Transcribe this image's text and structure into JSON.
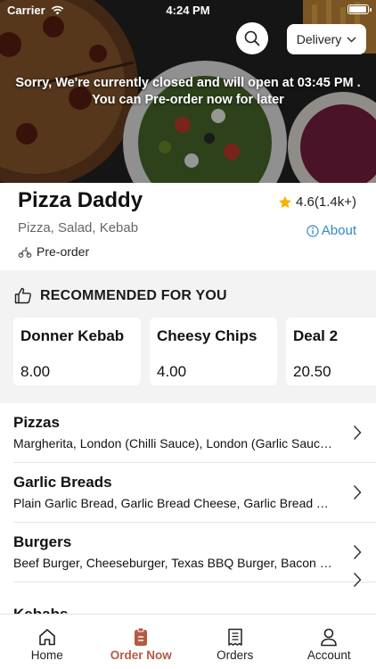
{
  "status_bar": {
    "carrier": "Carrier",
    "time": "4:24 PM"
  },
  "hero": {
    "message_line1": "Sorry, We're currently closed and will open at 03:45 PM .",
    "message_line2": "You can Pre-order now for later",
    "search_icon": "search-icon",
    "mode_selector": {
      "selected": "Delivery"
    }
  },
  "restaurant": {
    "name": "Pizza Daddy",
    "rating": "4.6(1.4k+)",
    "cuisine": "Pizza, Salad, Kebab",
    "about_label": "About",
    "preorder_label": "Pre-order"
  },
  "recommended": {
    "title": "RECOMMENDED FOR YOU",
    "items": [
      {
        "name": "Donner Kebab",
        "price": "8.00"
      },
      {
        "name": "Cheesy Chips",
        "price": "4.00"
      },
      {
        "name": "Deal 2",
        "price": "20.50"
      }
    ]
  },
  "categories": [
    {
      "title": "Pizzas",
      "description": "Margherita, London (Chilli Sauce), London (Garlic Sauce), Pepperoni"
    },
    {
      "title": "Garlic Breads",
      "description": "Plain Garlic Bread, Garlic Bread Cheese, Garlic Bread Tomato"
    },
    {
      "title": "Burgers",
      "description": "Beef Burger, Cheeseburger, Texas BBQ Burger, Bacon Burger"
    },
    {
      "title": "Kebabs",
      "description": ""
    }
  ],
  "tabbar": {
    "tabs": [
      {
        "label": "Home",
        "icon": "home-icon",
        "active": false
      },
      {
        "label": "Order Now",
        "icon": "order-icon",
        "active": true
      },
      {
        "label": "Orders",
        "icon": "receipt-icon",
        "active": false
      },
      {
        "label": "Account",
        "icon": "account-icon",
        "active": false
      }
    ]
  },
  "colors": {
    "accent": "#b35a45",
    "link": "#2d8bc8",
    "star": "#f4b400",
    "section_bg": "#f3f3f3"
  }
}
